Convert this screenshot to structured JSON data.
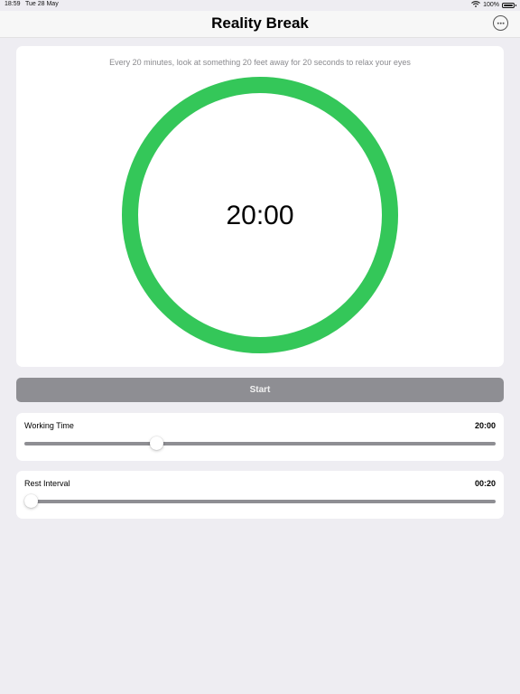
{
  "status_bar": {
    "time": "18:59",
    "date": "Tue 28 May",
    "battery": "100%",
    "icons": [
      "wifi-icon",
      "battery-icon"
    ]
  },
  "nav": {
    "title": "Reality Break",
    "more_icon": "ellipsis-circle-icon"
  },
  "timer": {
    "hint": "Every 20 minutes, look at something 20 feet away for 20 seconds to relax your eyes",
    "display": "20:00",
    "progress": 1.0,
    "ring_color": "#34c759"
  },
  "start_button": {
    "label": "Start",
    "color": "#8e8e93"
  },
  "settings": [
    {
      "label": "Working Time",
      "value": "20:00",
      "slider_fraction": 0.28
    },
    {
      "label": "Rest Interval",
      "value": "00:20",
      "slider_fraction": 0.0
    }
  ],
  "colors": {
    "background": "#eeedf2",
    "card": "#ffffff",
    "accent_green": "#34c759",
    "button_gray": "#8e8e93"
  }
}
